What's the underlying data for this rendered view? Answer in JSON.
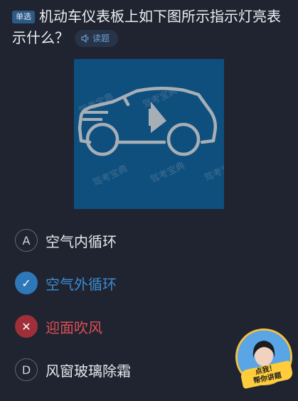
{
  "question": {
    "type_tag": "单选",
    "text": "机动车仪表板上如下图所示指示灯亮表示什么？",
    "read_button": "读题"
  },
  "figure": {
    "watermark": "驾考宝典",
    "background": "#0f4f7e",
    "icon": "car-outside-air-circulation-icon"
  },
  "options": [
    {
      "letter": "A",
      "text": "空气内循环",
      "state": "normal"
    },
    {
      "letter": "✓",
      "text": "空气外循环",
      "state": "correct"
    },
    {
      "letter": "✕",
      "text": "迎面吹风",
      "state": "wrong"
    },
    {
      "letter": "D",
      "text": "风窗玻璃除霜",
      "state": "normal"
    }
  ],
  "helper": {
    "label_line1": "点我！",
    "label_line2": "帮你讲题"
  },
  "colors": {
    "background": "#1f2430",
    "correct": "#2e77b8",
    "wrong": "#9f2f39",
    "accent": "#f3c046"
  }
}
